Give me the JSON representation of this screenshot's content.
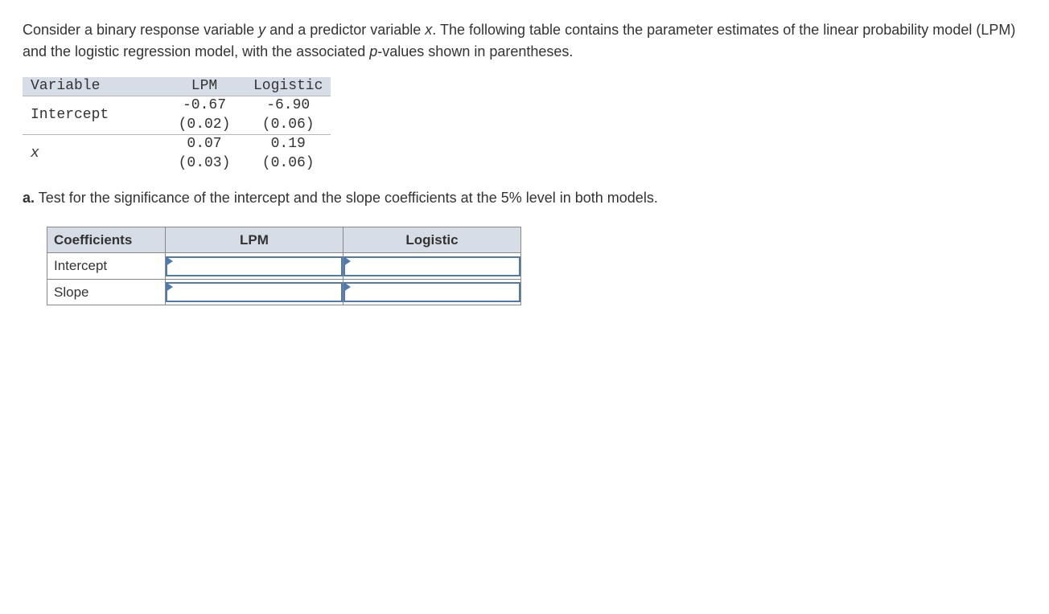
{
  "question": {
    "intro_before_y": "Consider a binary response variable ",
    "y": "y",
    "intro_mid1": " and a predictor variable ",
    "x": "x",
    "intro_after_x": ". The following table contains the parameter estimates of the linear probability model (LPM) and the logistic regression model, with the associated ",
    "p": "p",
    "intro_tail": "-values shown in parentheses."
  },
  "param_table": {
    "headers": {
      "variable": "Variable",
      "lpm": "LPM",
      "logistic": "Logistic"
    },
    "rows": [
      {
        "variable": "Intercept",
        "lpm_est": "-0.67",
        "lpm_p": "(0.02)",
        "log_est": "-6.90",
        "log_p": "(0.06)"
      },
      {
        "variable": "x",
        "lpm_est": "0.07",
        "lpm_p": "(0.03)",
        "log_est": "0.19",
        "log_p": "(0.06)"
      }
    ]
  },
  "part_a": {
    "label": "a.",
    "text": " Test for the significance of the intercept and the slope coefficients at the 5% level in both models."
  },
  "answer_table": {
    "headers": {
      "coeff": "Coefficients",
      "lpm": "LPM",
      "logistic": "Logistic"
    },
    "rows": [
      {
        "label": "Intercept"
      },
      {
        "label": "Slope"
      }
    ]
  }
}
